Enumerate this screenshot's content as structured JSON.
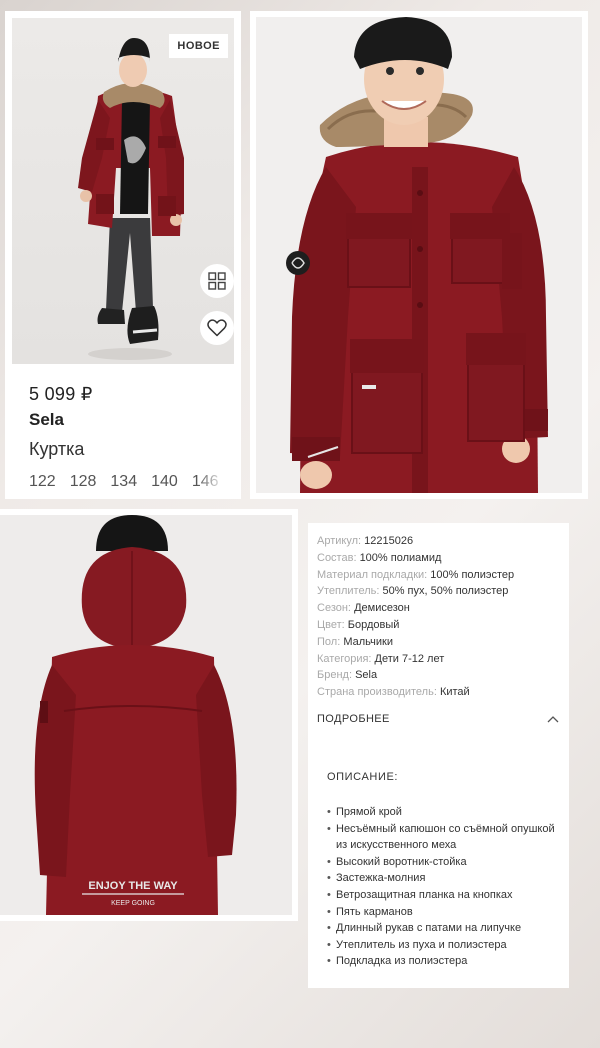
{
  "colors": {
    "jacket": "#8b1a22",
    "jacket_dark": "#6f1219",
    "fur": "#a88a68",
    "hat": "#1a1a1a"
  },
  "product": {
    "badge": "НОВОЕ",
    "price": "5 099 ₽",
    "brand": "Sela",
    "type": "Куртка",
    "sizes": [
      "122",
      "128",
      "134",
      "140",
      "146"
    ],
    "icons": {
      "similar": "grid-icon",
      "favorite": "heart-icon"
    }
  },
  "back_print": {
    "line1": "ENJOY THE WAY",
    "line2": "KEEP GOING"
  },
  "specs": [
    {
      "key": "Артикул:",
      "value": "12215026"
    },
    {
      "key": "Состав:",
      "value": "100% полиамид"
    },
    {
      "key": "Материал подкладки:",
      "value": "100% полиэстер"
    },
    {
      "key": "Утеплитель:",
      "value": "50% пух, 50% полиэстер"
    },
    {
      "key": "Сезон:",
      "value": "Демисезон"
    },
    {
      "key": "Цвет:",
      "value": "Бордовый"
    },
    {
      "key": "Пол:",
      "value": "Мальчики"
    },
    {
      "key": "Категория:",
      "value": "Дети 7-12 лет"
    },
    {
      "key": "Бренд:",
      "value": "Sela"
    },
    {
      "key": "Страна производитель:",
      "value": "Китай"
    }
  ],
  "details": {
    "more_label": "ПОДРОБНЕЕ",
    "description_title": "ОПИСАНИЕ:",
    "features": [
      "Прямой крой",
      "Несъёмный капюшон со съёмной опушкой из искусственного меха",
      "Высокий воротник-стойка",
      "Застежка-молния",
      "Ветрозащитная планка на кнопках",
      "Пять карманов",
      "Длинный рукав с патами на липучке",
      "Утеплитель из пуха и полиэстера",
      "Подкладка из полиэстера"
    ]
  }
}
